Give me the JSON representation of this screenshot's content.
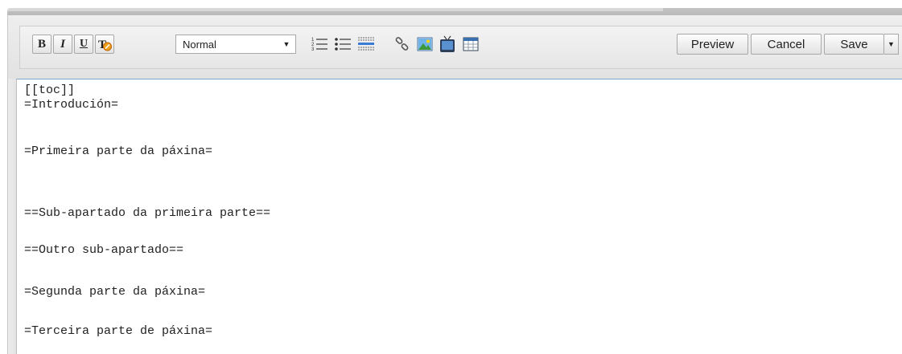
{
  "toolbar": {
    "bold_label": "B",
    "italic_label": "I",
    "underline_label": "U",
    "format_select_value": "Normal",
    "preview_label": "Preview",
    "cancel_label": "Cancel",
    "save_label": "Save"
  },
  "icons": {
    "clear_format": "clear-formatting-icon",
    "ordered_list": "ordered-list-icon",
    "unordered_list": "unordered-list-icon",
    "horizontal_rule": "horizontal-rule-icon",
    "link": "link-icon",
    "image": "image-icon",
    "media": "tv-media-icon",
    "table": "table-icon"
  },
  "editor": {
    "lines": [
      "[[toc]]",
      "=Introdución=",
      "",
      "=Primeira parte da páxina=",
      "",
      "",
      "==Sub-apartado da primeira parte==",
      "",
      "==Outro sub-apartado==",
      "",
      "=Segunda parte da páxina=",
      "",
      "=Terceira parte de páxina="
    ]
  },
  "colors": {
    "editor_focus_border": "#7fa7c9",
    "toolbar_bg": "#e6e6e6"
  }
}
